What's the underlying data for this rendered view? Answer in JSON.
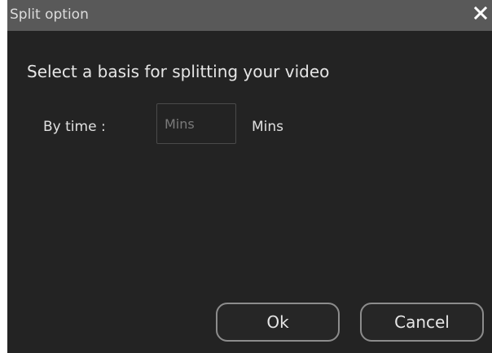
{
  "window": {
    "title": "Split option",
    "close_icon": "close-icon"
  },
  "content": {
    "prompt": "Select a basis for splitting your video",
    "by_time_label": "By time :",
    "mins_input_value": "",
    "mins_input_placeholder": "Mins",
    "mins_unit": "Mins"
  },
  "buttons": {
    "ok_label": "Ok",
    "cancel_label": "Cancel"
  },
  "colors": {
    "titlebar": "#595959",
    "body": "#232323",
    "button_border": "#8c8c8c"
  }
}
